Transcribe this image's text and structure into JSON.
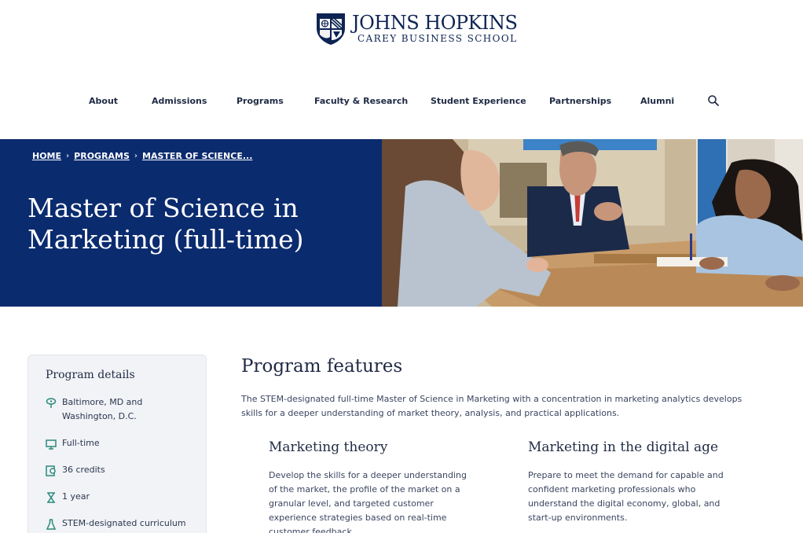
{
  "header": {
    "logo_name": "JOHNS HOPKINS",
    "logo_sub": "CAREY BUSINESS SCHOOL"
  },
  "nav": {
    "items": [
      "About",
      "Admissions",
      "Programs",
      "Faculty & Research",
      "Student Experience",
      "Partnerships",
      "Alumni"
    ],
    "search_icon": "search-icon"
  },
  "hero": {
    "breadcrumb": [
      "HOME",
      "PROGRAMS",
      "MASTER OF SCIENCE..."
    ],
    "title": "Master of Science in Marketing (full-time)"
  },
  "sidebar": {
    "title": "Program details",
    "details": [
      {
        "icon": "map-pin-icon",
        "text": "Baltimore, MD and Washington, D.C."
      },
      {
        "icon": "monitor-icon",
        "text": "Full-time"
      },
      {
        "icon": "certificate-icon",
        "text": "36 credits"
      },
      {
        "icon": "hourglass-icon",
        "text": "1 year"
      },
      {
        "icon": "flask-icon",
        "text": "STEM-designated curriculum"
      }
    ]
  },
  "main": {
    "title": "Program features",
    "intro": "The STEM-designated full-time Master of Science in Marketing with a concentration in marketing analytics develops skills for a deeper understanding of market theory, analysis, and practical applications.",
    "columns": [
      {
        "title": "Marketing theory",
        "text": "Develop the skills for a deeper understanding of the market, the profile of the market on a granular level, and targeted customer experience strategies based on real-time customer feedback."
      },
      {
        "title": "Marketing in the digital age",
        "text": "Prepare to meet the demand for capable and confident marketing professionals who understand the digital economy, global, and start-up environments."
      }
    ]
  },
  "colors": {
    "navy": "#0b2b6f",
    "accent_teal": "#2a8a7b",
    "text": "#1f2a44"
  }
}
